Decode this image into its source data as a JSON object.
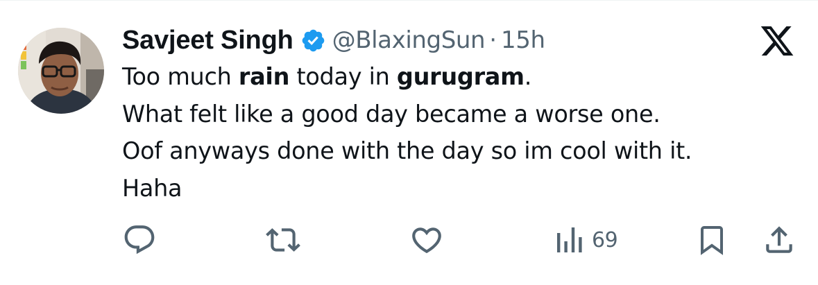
{
  "tweet": {
    "display_name": "Savjeet Singh",
    "verified": true,
    "verified_icon": "verified-badge-icon",
    "handle": "@BlaxingSun",
    "separator": "·",
    "time": "15h",
    "text_lines": [
      [
        {
          "text": "Too much ",
          "bold": false
        },
        {
          "text": "rain",
          "bold": true
        },
        {
          "text": " today in ",
          "bold": false
        },
        {
          "text": "gurugram",
          "bold": true
        },
        {
          "text": ".",
          "bold": false
        }
      ],
      [
        {
          "text": "What felt like a good day became a worse one.",
          "bold": false
        }
      ],
      [
        {
          "text": "Oof anyways done with the day so im cool with it.",
          "bold": false
        }
      ],
      [
        {
          "text": "Haha",
          "bold": false
        }
      ]
    ]
  },
  "actions": {
    "reply_icon": "reply-icon",
    "retweet_icon": "retweet-icon",
    "like_icon": "heart-icon",
    "views_icon": "views-chart-icon",
    "views_count": "69",
    "bookmark_icon": "bookmark-icon",
    "share_icon": "share-icon"
  },
  "colors": {
    "text": "#0f1419",
    "secondary": "#536471",
    "verified": "#1d9bf0"
  },
  "logo": "x-logo-icon"
}
